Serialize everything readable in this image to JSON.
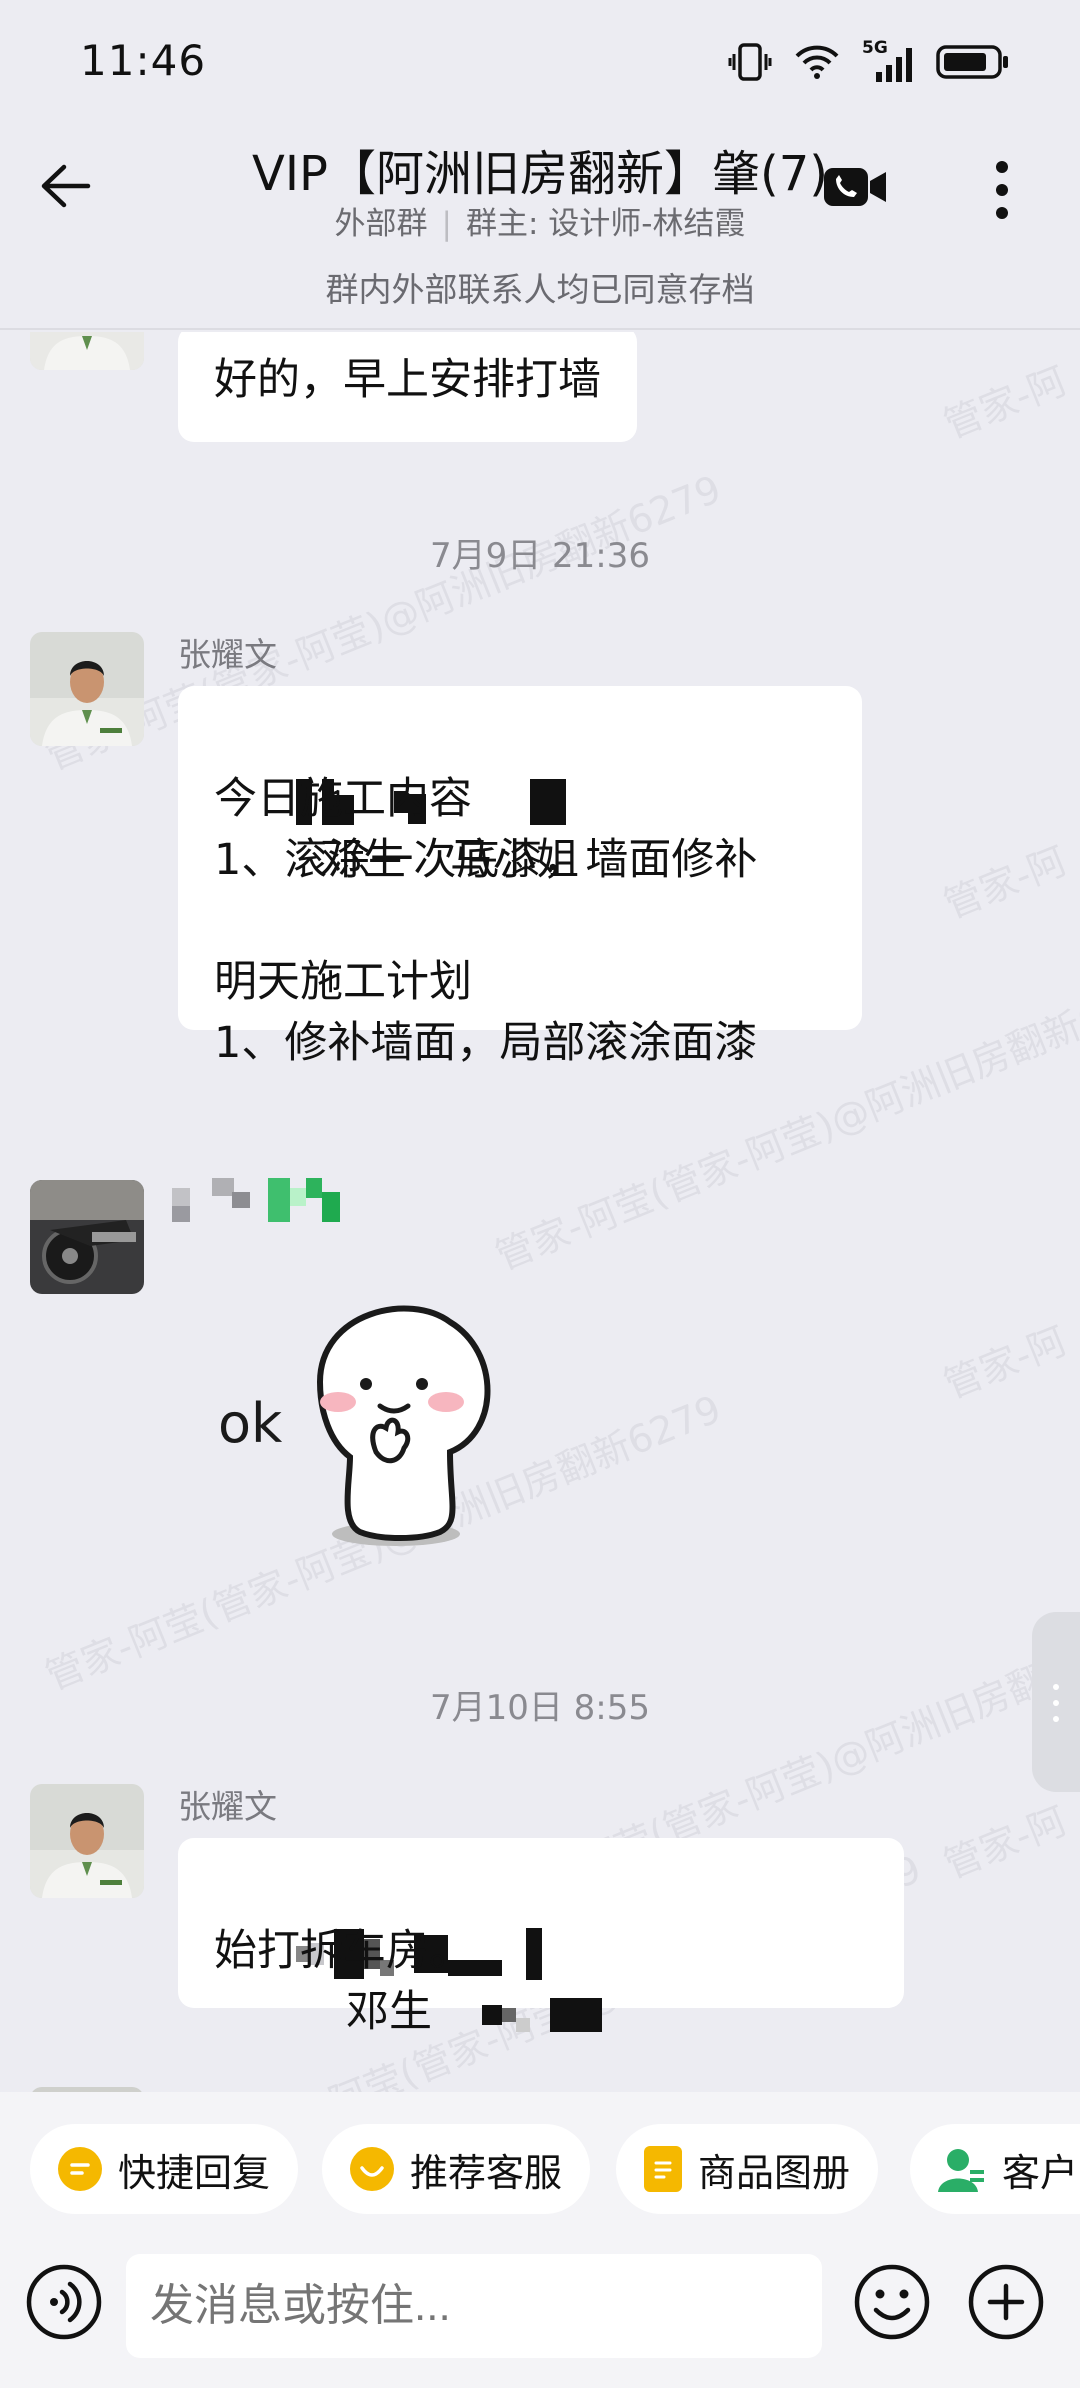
{
  "status_bar": {
    "time": "11:46",
    "network": "5G"
  },
  "header": {
    "title": "VIP【阿洲旧房翻新】肇(7)",
    "subtitle_group_type": "外部群",
    "subtitle_owner": "群主: 设计师-林结霞",
    "notice": "群内外部联系人均已同意存档"
  },
  "watermark_text": "管家-阿莹(管家-阿莹)@阿洲旧房翻新6279",
  "messages": [
    {
      "text": "好的，早上安排打墙"
    },
    {
      "timestamp": "7月9日  21:36"
    },
    {
      "sender": "张耀文",
      "line1_names": [
        "邓生",
        "马小姐"
      ],
      "lines": [
        "今日施工内容",
        "1、滚涂一次底漆，墙面修补",
        "",
        "明天施工计划",
        "1、修补墙面，局部滚涂面漆"
      ]
    },
    {
      "sticker_text": "ok"
    },
    {
      "timestamp": "7月10日  8:55"
    },
    {
      "sender": "张耀文",
      "line1_names": [
        "邓生"
      ],
      "lines": [
        "始打拆车房。"
      ]
    }
  ],
  "quick_actions": [
    {
      "label": "快捷回复",
      "icon": "quick-reply-icon",
      "color": "#f5b800"
    },
    {
      "label": "推荐客服",
      "icon": "recommend-service-icon",
      "color": "#f5b800"
    },
    {
      "label": "商品图册",
      "icon": "product-album-icon",
      "color": "#f5b800"
    },
    {
      "label": "客户",
      "icon": "customer-icon",
      "color": "#2aae67"
    }
  ],
  "input": {
    "placeholder": "发消息或按住..."
  }
}
